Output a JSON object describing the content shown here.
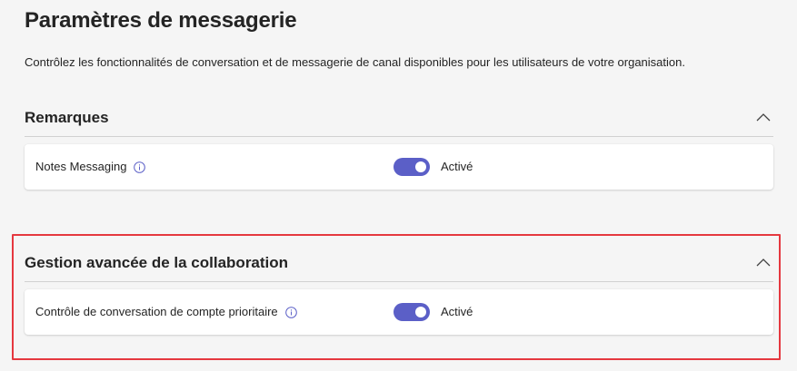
{
  "page": {
    "title": "Paramètres de messagerie",
    "description": "Contrôlez les fonctionnalités de conversation et de messagerie de canal disponibles pour les utilisateurs de votre organisation."
  },
  "sections": [
    {
      "title": "Remarques",
      "expanded": true,
      "chevron_icon": "chevron-up-icon",
      "setting": {
        "label": "Notes Messaging",
        "info_icon": "info-icon",
        "toggle_on": true,
        "toggle_label": "Activé"
      }
    },
    {
      "title": "Gestion avancée de la collaboration",
      "expanded": true,
      "chevron_icon": "chevron-up-icon",
      "highlighted": true,
      "setting": {
        "label": "Contrôle de conversation de compte prioritaire",
        "info_icon": "info-icon",
        "toggle_on": true,
        "toggle_label": "Activé"
      }
    }
  ],
  "colors": {
    "accent": "#5b5fc7",
    "highlight_border": "#e5383f",
    "background": "#f5f5f5",
    "card": "#ffffff",
    "text": "#242424"
  }
}
